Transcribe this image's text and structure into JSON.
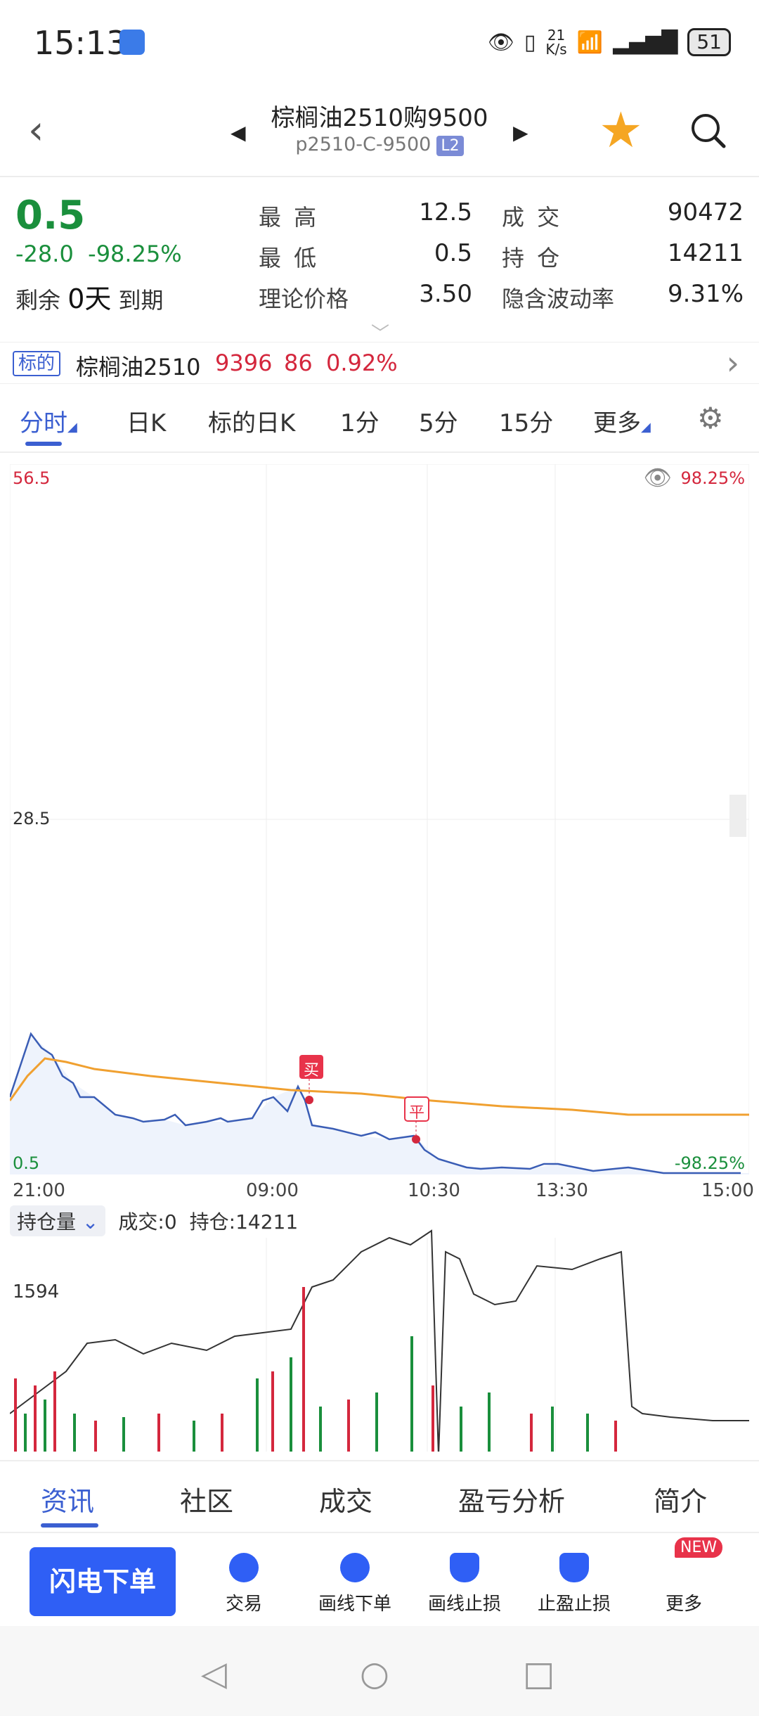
{
  "status": {
    "time": "15:13",
    "net_speed_top": "21",
    "net_speed_unit": "K/s",
    "battery": "51"
  },
  "header": {
    "title": "棕榈油2510购9500",
    "code": "p2510-C-9500",
    "level": "L2"
  },
  "quote": {
    "price": "0.5",
    "change": "-28.0",
    "change_pct": "-98.25%",
    "remain_label": "剩余",
    "remain_days": "0天",
    "expire_label": "到期",
    "high_label": "最 高",
    "high": "12.5",
    "low_label": "最 低",
    "low": "0.5",
    "theo_label": "理论价格",
    "theo": "3.50",
    "volume_label": "成 交",
    "volume": "90472",
    "oi_label": "持 仓",
    "oi": "14211",
    "iv_label": "隐含波动率",
    "iv": "9.31%"
  },
  "underlying": {
    "tag": "标的",
    "name": "棕榈油2510",
    "price": "9396",
    "change": "86",
    "change_pct": "0.92%"
  },
  "tabs": [
    "分时",
    "日K",
    "标的日K",
    "1分",
    "5分",
    "15分",
    "更多"
  ],
  "chart_labels": {
    "y_top": "56.5",
    "y_mid": "28.5",
    "y_bottom": "0.5",
    "pct_top": "98.25%",
    "pct_bottom": "-98.25%",
    "buy": "买",
    "close": "平"
  },
  "x_ticks": [
    "21:00",
    "09:00",
    "10:30",
    "13:30",
    "15:00"
  ],
  "vol_header": {
    "selector": "持仓量",
    "volume": "成交:0",
    "oi": "持仓:14211",
    "y_label": "1594"
  },
  "info_tabs": [
    "资讯",
    "社区",
    "成交",
    "盈亏分析",
    "简介"
  ],
  "actions": {
    "flash": "闪电下单",
    "trade": "交易",
    "draw_order": "画线下单",
    "draw_stop": "画线止损",
    "tp_sl": "止盈止损",
    "more": "更多",
    "new_tag": "NEW"
  },
  "colors": {
    "accent": "#3b5fd1",
    "up": "#d4273d",
    "down": "#1a8f3c",
    "price_line": "#3a5db5",
    "avg_line": "#f0a030"
  },
  "chart_data": {
    "type": "line",
    "ylim": [
      0.5,
      56.5
    ],
    "x": [
      "21:00",
      "09:00",
      "10:30",
      "13:30",
      "15:00"
    ],
    "series": []
  }
}
